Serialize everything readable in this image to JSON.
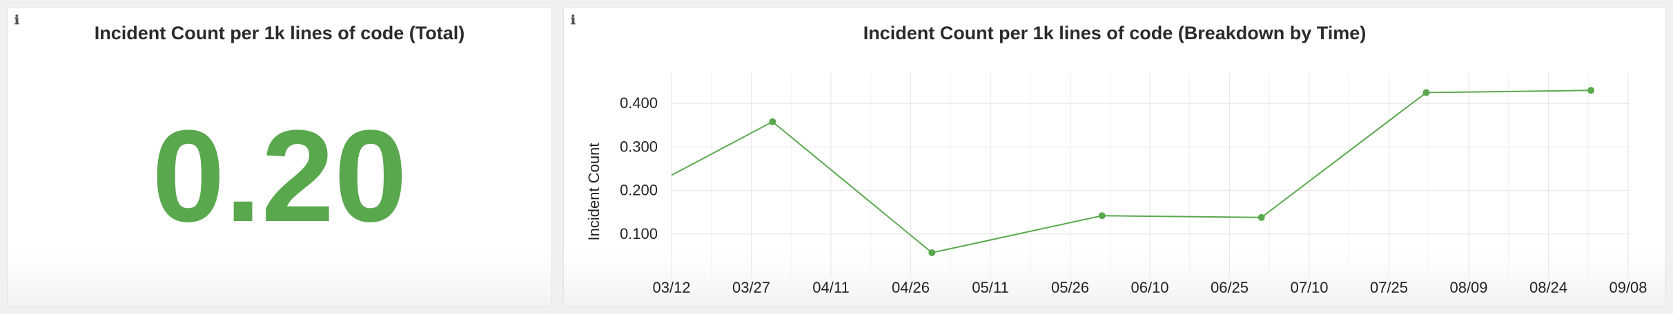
{
  "panels": {
    "total": {
      "info_icon": "info-icon",
      "title": "Incident Count per 1k lines of code (Total)",
      "value": "0.20"
    },
    "time": {
      "info_icon": "info-icon",
      "title": "Incident Count per 1k lines of code (Breakdown by Time)"
    }
  },
  "colors": {
    "accent": "#5aa84e",
    "grid": "#e6e6e6"
  },
  "chart_data": {
    "type": "line",
    "title": "Incident Count per 1k lines of code (Breakdown by Time)",
    "ylabel": "Incident Count",
    "xlabel": "",
    "x_ticks": [
      "03/12",
      "03/27",
      "04/11",
      "04/26",
      "05/11",
      "05/26",
      "06/10",
      "06/25",
      "07/10",
      "07/25",
      "08/09",
      "08/24",
      "09/08"
    ],
    "y_ticks": [
      "0.100",
      "0.200",
      "0.300",
      "0.400"
    ],
    "y_tick_values": [
      0.1,
      0.2,
      0.3,
      0.4
    ],
    "ylim": [
      0.0,
      0.47
    ],
    "grid": true,
    "series": [
      {
        "x": [
          "03/12",
          "03/31",
          "04/30",
          "06/01",
          "07/01",
          "08/01",
          "09/01"
        ],
        "y": [
          0.235,
          0.358,
          0.057,
          0.142,
          0.138,
          0.425,
          0.43
        ],
        "markers": [
          false,
          true,
          true,
          true,
          true,
          true,
          true
        ]
      }
    ]
  }
}
